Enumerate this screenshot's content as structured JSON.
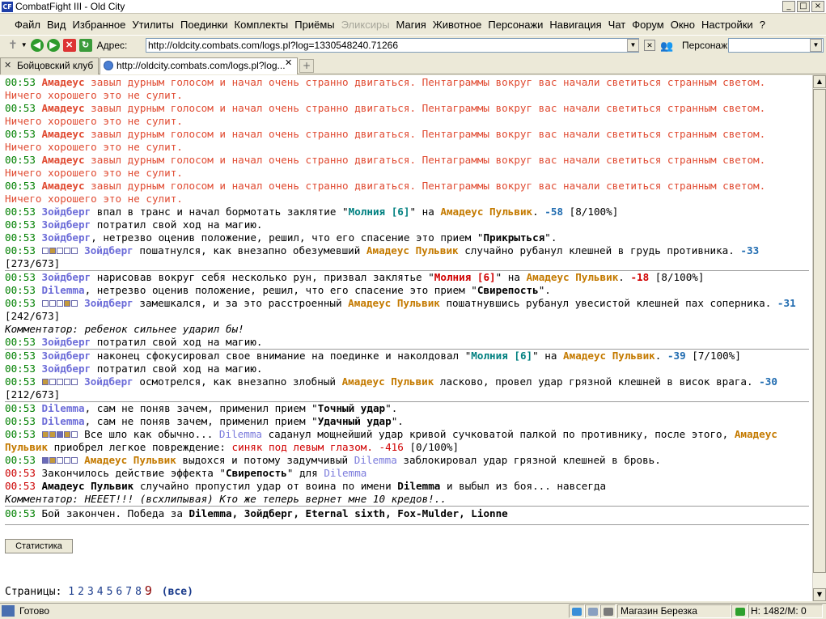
{
  "title": "CombatFight III - Old City",
  "app_icon": "CF",
  "window_controls": [
    "_",
    "□",
    "×"
  ],
  "menu": [
    "Файл",
    "Вид",
    "Избранное",
    "Утилиты",
    "Поединки",
    "Комплекты",
    "Приёмы",
    "Эликсиры",
    "Магия",
    "Животное",
    "Персонажи",
    "Навигация",
    "Чат",
    "Форум",
    "Окно",
    "Настройки",
    "?"
  ],
  "address_label": "Адрес:",
  "address_url": "http://oldcity.combats.com/logs.pl?log=1330548240.71266",
  "character_label": "Персонаж:",
  "tabs": [
    {
      "label": "Бойцовский клуб",
      "active": false
    },
    {
      "label": "http://oldcity.combats.com/logs.pl?log...",
      "active": true
    }
  ],
  "log_time": "00:53",
  "names": {
    "amadeus": "Амадеус",
    "amadeus_full": "Амадеус Пульвик",
    "zoidberg": "Зойдберг",
    "dilemma": "Dilemma"
  },
  "texts": {
    "pentagram": " завыл дурным голосом и начал очень странно двигаться. Пентаграммы вокруг вас начали светиться странным светом. Ничего хорошего это не сулит.",
    "trance_a": " впал в транс и начал бормотать заклятие \"",
    "spell_lightning": "Молния [6]",
    "on": "\" на ",
    "dmg_58": "-58",
    "mana_8": " [8/100%]",
    "spent_magic": " потратил свой ход на магию.",
    "sober_a": ", нетрезво оценив положение, решил, что его спасение это прием \"",
    "cover": "Прикрыться",
    "close_q": "\".",
    "stagger": " пошатнулся, как внезапно обезумевший ",
    "cut_chest": " случайно рубанул клешней в грудь противника. ",
    "dmg_33": "-33",
    "hp_273": "[273/673]",
    "runes_a": " нарисовав вокруг себя несколько рун, призвал заклятье \"",
    "dmg_18": "-18",
    "fury": "Свирепость",
    "hesitate": " замешкался, и за это расстроенный ",
    "cut_groin": " пошатнувшись рубанул увесистой клешней пах соперника. ",
    "dmg_31": "-31",
    "hp_242": "[242/673]",
    "comment1": "Комментатор: ребенок сильнее ударил бы!",
    "focus_a": " наконец сфокусировал свое внимание на поединке и наколдовал \"",
    "dmg_39": "-39",
    "mana_7": " [7/100%]",
    "look_around": " осмотрелся, как внезапно злобный ",
    "kind_hit": " ласково, провел удар грязной клешней в висок врага. ",
    "dmg_30": "-30",
    "hp_212": "[212/673]",
    "without_understanding": ", сам не поняв зачем, применил прием \"",
    "precise": "Точный удар",
    "lucky": "Удачный удар",
    "as_usual": " Все шло как обычно... ",
    "heavy_hit": " саданул мощнейший удар кривой сучковатой палкой по противнику, после этого, ",
    "got_injury": " приобрел легкое повреждение: ",
    "injury": "синяк под левым глазом. -416",
    "mana_0": " [0/100%]",
    "exhale": " выдохся и потому задумчивый ",
    "blocked": " заблокировал удар грязной клешней в бровь.",
    "effect_end": "Закончилось действие эффекта \"",
    "for": "\" для ",
    "missed": " случайно пропустил удар от воина по имени ",
    "knocked": " и выбыл из боя... навсегда",
    "comment2": "Комментатор: НЕЕЕТ!!! (всхлипывая) Кто же теперь вернет мне 10 кредов!..",
    "battle_end": "Бой закончен. Победа за ",
    "winners": "Dilemma, Зойдберг, Eternal sixth, Fox-Mulder, Lionne"
  },
  "stats_button": "Статистика",
  "pages_label": "Страницы:",
  "pages": [
    "1",
    "2",
    "3",
    "4",
    "5",
    "6",
    "7",
    "8"
  ],
  "current_page": "9",
  "all_pages": "(все)",
  "status": {
    "text": "Готово",
    "shop": "Магазин Березка",
    "position": "H: 1482/M: 0"
  }
}
